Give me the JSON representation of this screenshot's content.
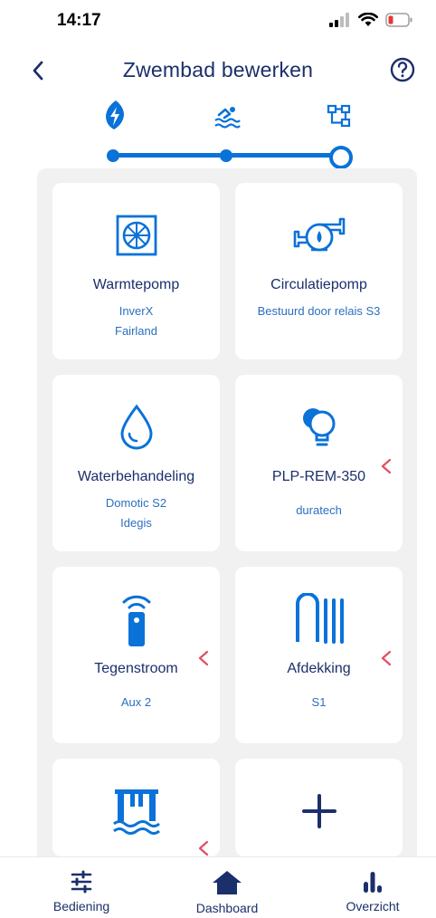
{
  "status": {
    "time": "14:17"
  },
  "header": {
    "title": "Zwembad bewerken",
    "back_icon": "chevron-left-icon",
    "help_icon": "question-circle-icon"
  },
  "stepper": {
    "steps": [
      {
        "icon": "energy-icon"
      },
      {
        "icon": "swimmer-icon"
      },
      {
        "icon": "network-icon"
      }
    ],
    "active_step": 3
  },
  "cards": [
    {
      "title": "Warmtepomp",
      "sub1": "InverX",
      "sub2": "Fairland",
      "icon": "heatpump-icon",
      "warning": false
    },
    {
      "title": "Circulatiepomp",
      "sub1": "Bestuurd door relais S3",
      "sub2": "",
      "icon": "pump-icon",
      "warning": false
    },
    {
      "title": "Waterbehandeling",
      "sub1": "Domotic S2",
      "sub2": "Idegis",
      "icon": "water-drop-icon",
      "warning": false
    },
    {
      "title": "PLP-REM-350",
      "sub1": "duratech",
      "sub2": "",
      "icon": "lights-icon",
      "warning": true
    },
    {
      "title": "Tegenstroom",
      "sub1": "Aux 2",
      "sub2": "",
      "icon": "remote-icon",
      "warning": true
    },
    {
      "title": "Afdekking",
      "sub1": "S1",
      "sub2": "",
      "icon": "cover-icon",
      "warning": true
    },
    {
      "title": "",
      "sub1": "",
      "sub2": "",
      "icon": "pool-ladder-icon",
      "warning": true
    },
    {
      "title": "",
      "sub1": "",
      "sub2": "",
      "icon": "plus-icon",
      "warning": false
    }
  ],
  "nav": {
    "items": [
      {
        "label": "Bediening",
        "icon": "sliders-icon"
      },
      {
        "label": "Dashboard",
        "icon": "home-icon"
      },
      {
        "label": "Overzicht",
        "icon": "bar-chart-icon"
      }
    ]
  },
  "colors": {
    "primary": "#0a72d8",
    "title": "#1b2f6b",
    "accent": "#2b6fc1",
    "warning": "#e0505e",
    "background": "#f1f1f1"
  }
}
